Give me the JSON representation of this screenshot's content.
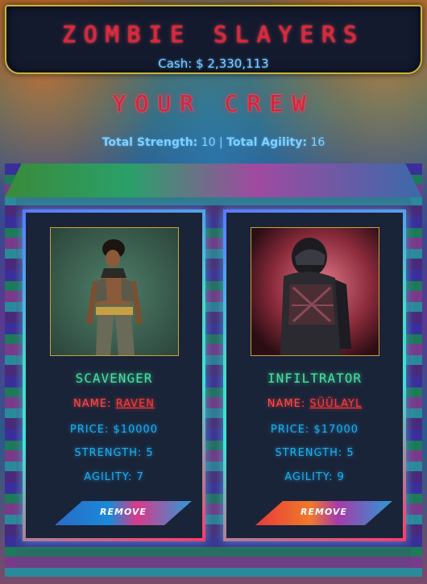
{
  "header": {
    "title": "ZOMBIE SLAYERS",
    "cash_text": "Cash: $ 2,330,113"
  },
  "crew": {
    "heading": "YOUR CREW",
    "totals": {
      "strength_label": "Total Strength:",
      "strength_value": "10",
      "separator": "|",
      "agility_label": "Total Agility:",
      "agility_value": "16"
    },
    "members": [
      {
        "role": "SCAVENGER",
        "name_label": "NAME:",
        "name": "RAVEN",
        "price": "PRICE: $10000",
        "strength": "STRENGTH: 5",
        "agility": "AGILITY: 7",
        "button_label": "REMOVE"
      },
      {
        "role": "INFILTRATOR",
        "name_label": "NAME:",
        "name": "SÜÜLAYL",
        "price": "PRICE: $17000",
        "strength": "STRENGTH: 5",
        "agility": "AGILITY: 9",
        "button_label": "REMOVE"
      }
    ]
  },
  "colors": {
    "title_red": "#e0243a",
    "cash_blue": "#7fd0ff",
    "role_green": "#4ae0a0",
    "stat_blue": "#1ab0f0",
    "header_border_gold": "#c9b73a"
  }
}
